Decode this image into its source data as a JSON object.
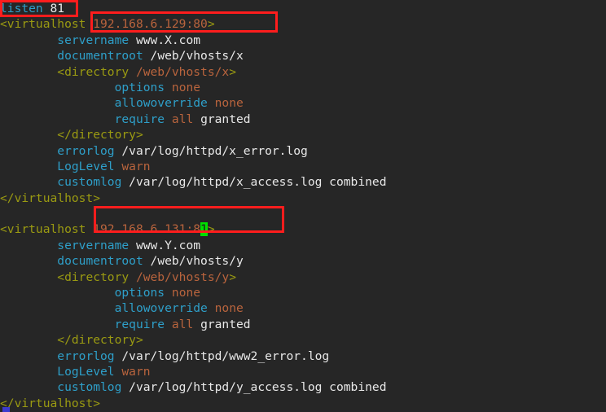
{
  "terminal": {
    "background_color": "#262626",
    "colors": {
      "keyword": "#2e9fc9",
      "value": "#e8e8e8",
      "tag": "#9a9a12",
      "argument": "#b9643d",
      "cursor_background": "#00e000",
      "highlight_box": "#ff1d1d"
    },
    "cursor": {
      "character": "1",
      "line_index": 14,
      "description": "block-cursor"
    },
    "lines": [
      {
        "indent": 0,
        "parts": [
          {
            "t": "listen",
            "c": "kw"
          },
          {
            "t": " ",
            "c": "pad"
          },
          {
            "t": "81",
            "c": "val"
          }
        ]
      },
      {
        "indent": 0,
        "parts": [
          {
            "t": "<virtualhost ",
            "c": "tag"
          },
          {
            "t": "192.168.6.129:80",
            "c": "arg"
          },
          {
            "t": ">",
            "c": "tag"
          }
        ]
      },
      {
        "indent": 8,
        "parts": [
          {
            "t": "servername",
            "c": "kw"
          },
          {
            "t": " ",
            "c": "pad"
          },
          {
            "t": "www.X.com",
            "c": "val"
          }
        ]
      },
      {
        "indent": 8,
        "parts": [
          {
            "t": "documentroot",
            "c": "kw"
          },
          {
            "t": " ",
            "c": "pad"
          },
          {
            "t": "/web/vhosts/x",
            "c": "val"
          }
        ]
      },
      {
        "indent": 8,
        "parts": [
          {
            "t": "<directory ",
            "c": "tag"
          },
          {
            "t": "/web/vhosts/x",
            "c": "arg"
          },
          {
            "t": ">",
            "c": "tag"
          }
        ]
      },
      {
        "indent": 16,
        "parts": [
          {
            "t": "options",
            "c": "kw"
          },
          {
            "t": " ",
            "c": "pad"
          },
          {
            "t": "none",
            "c": "arg"
          }
        ]
      },
      {
        "indent": 16,
        "parts": [
          {
            "t": "allowoverride",
            "c": "kw"
          },
          {
            "t": " ",
            "c": "pad"
          },
          {
            "t": "none",
            "c": "arg"
          }
        ]
      },
      {
        "indent": 16,
        "parts": [
          {
            "t": "require",
            "c": "kw"
          },
          {
            "t": " ",
            "c": "pad"
          },
          {
            "t": "all",
            "c": "arg"
          },
          {
            "t": " ",
            "c": "pad"
          },
          {
            "t": "granted",
            "c": "val"
          }
        ]
      },
      {
        "indent": 8,
        "parts": [
          {
            "t": "</directory>",
            "c": "tag"
          }
        ]
      },
      {
        "indent": 8,
        "parts": [
          {
            "t": "errorlog",
            "c": "kw"
          },
          {
            "t": " ",
            "c": "pad"
          },
          {
            "t": "/var/log/httpd/x_error.log",
            "c": "val"
          }
        ]
      },
      {
        "indent": 8,
        "parts": [
          {
            "t": "LogLevel",
            "c": "kw"
          },
          {
            "t": " ",
            "c": "pad"
          },
          {
            "t": "warn",
            "c": "arg"
          }
        ]
      },
      {
        "indent": 8,
        "parts": [
          {
            "t": "customlog",
            "c": "kw"
          },
          {
            "t": " ",
            "c": "pad"
          },
          {
            "t": "/var/log/httpd/x_access.log combined",
            "c": "val"
          }
        ]
      },
      {
        "indent": 0,
        "parts": [
          {
            "t": "</virtualhost>",
            "c": "tag"
          }
        ]
      },
      {
        "indent": 0,
        "parts": []
      },
      {
        "indent": 0,
        "parts": [
          {
            "t": "<virtualhost ",
            "c": "tag"
          },
          {
            "t": "192.168.6.131:8",
            "c": "arg"
          },
          {
            "t": "1",
            "c": "cursor"
          },
          {
            "t": ">",
            "c": "tag"
          }
        ]
      },
      {
        "indent": 8,
        "parts": [
          {
            "t": "servername",
            "c": "kw"
          },
          {
            "t": " ",
            "c": "pad"
          },
          {
            "t": "www.Y.com",
            "c": "val"
          }
        ]
      },
      {
        "indent": 8,
        "parts": [
          {
            "t": "documentroot",
            "c": "kw"
          },
          {
            "t": " ",
            "c": "pad"
          },
          {
            "t": "/web/vhosts/y",
            "c": "val"
          }
        ]
      },
      {
        "indent": 8,
        "parts": [
          {
            "t": "<directory ",
            "c": "tag"
          },
          {
            "t": "/web/vhosts/y",
            "c": "arg"
          },
          {
            "t": ">",
            "c": "tag"
          }
        ]
      },
      {
        "indent": 16,
        "parts": [
          {
            "t": "options",
            "c": "kw"
          },
          {
            "t": " ",
            "c": "pad"
          },
          {
            "t": "none",
            "c": "arg"
          }
        ]
      },
      {
        "indent": 16,
        "parts": [
          {
            "t": "allowoverride",
            "c": "kw"
          },
          {
            "t": " ",
            "c": "pad"
          },
          {
            "t": "none",
            "c": "arg"
          }
        ]
      },
      {
        "indent": 16,
        "parts": [
          {
            "t": "require",
            "c": "kw"
          },
          {
            "t": " ",
            "c": "pad"
          },
          {
            "t": "all",
            "c": "arg"
          },
          {
            "t": " ",
            "c": "pad"
          },
          {
            "t": "granted",
            "c": "val"
          }
        ]
      },
      {
        "indent": 8,
        "parts": [
          {
            "t": "</directory>",
            "c": "tag"
          }
        ]
      },
      {
        "indent": 8,
        "parts": [
          {
            "t": "errorlog",
            "c": "kw"
          },
          {
            "t": " ",
            "c": "pad"
          },
          {
            "t": "/var/log/httpd/www2_error.log",
            "c": "val"
          }
        ]
      },
      {
        "indent": 8,
        "parts": [
          {
            "t": "LogLevel",
            "c": "kw"
          },
          {
            "t": " ",
            "c": "pad"
          },
          {
            "t": "warn",
            "c": "arg"
          }
        ]
      },
      {
        "indent": 8,
        "parts": [
          {
            "t": "customlog",
            "c": "kw"
          },
          {
            "t": " ",
            "c": "pad"
          },
          {
            "t": "/var/log/httpd/y_access.log combined",
            "c": "val"
          }
        ]
      },
      {
        "indent": 0,
        "parts": [
          {
            "t": "</virtualhost>",
            "c": "tag"
          }
        ]
      }
    ],
    "annotations": [
      {
        "id": "hl-listen",
        "label": "listen 81"
      },
      {
        "id": "hl-vhost-1",
        "label": "192.168.6.129:80>"
      },
      {
        "id": "hl-vhost-2",
        "label": "192.168.6.131:81>"
      }
    ]
  }
}
